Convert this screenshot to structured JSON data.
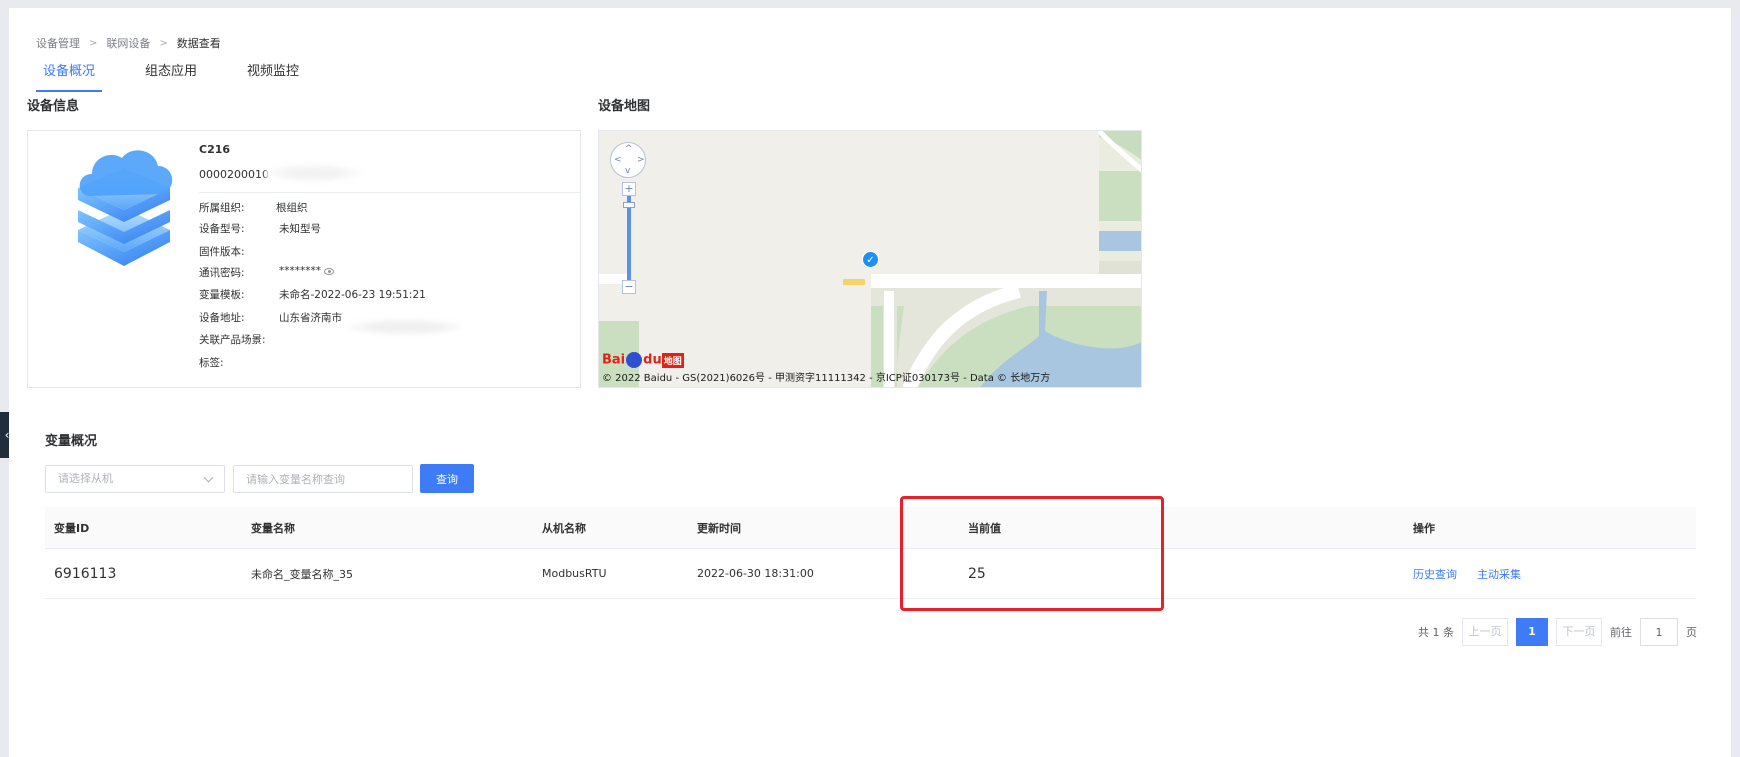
{
  "breadcrumb": [
    "设备管理",
    "联网设备",
    "数据查看"
  ],
  "tabs": [
    {
      "label": "设备概况",
      "active": true
    },
    {
      "label": "组态应用",
      "active": false
    },
    {
      "label": "视频监控",
      "active": false
    }
  ],
  "device_info": {
    "title": "设备信息",
    "name": "C216",
    "code": "0000200010",
    "rows": [
      {
        "label": "所属组织:",
        "value": "根组织"
      },
      {
        "label": "设备型号:",
        "value": "未知型号"
      },
      {
        "label": "固件版本:",
        "value": ""
      },
      {
        "label": "通讯密码:",
        "value": "********"
      },
      {
        "label": "变量模板:",
        "value": "未命名-2022-06-23 19:51:21"
      },
      {
        "label": "设备地址:",
        "value": "山东省济南市"
      },
      {
        "label": "关联产品场景:",
        "value": ""
      },
      {
        "label": "标签:",
        "value": ""
      }
    ]
  },
  "device_map": {
    "title": "设备地图",
    "copyright": "© 2022 Baidu - GS(2021)6026号 - 甲测资字11111342 - 京ICP证030173号 - Data © 长地万方",
    "logo_text": "Bai",
    "logo_text2": "du",
    "logo_map": "地图"
  },
  "variables": {
    "title": "变量概况",
    "select_placeholder": "请选择从机",
    "search_placeholder": "请输入变量名称查询",
    "query_label": "查询",
    "columns": [
      "变量ID",
      "变量名称",
      "从机名称",
      "更新时间",
      "当前值",
      "操作"
    ],
    "rows": [
      {
        "id": "6916113",
        "name": "未命名_变量名称_35",
        "slave": "ModbusRTU",
        "time": "2022-06-30 18:31:00",
        "value": "25",
        "actions": [
          "历史查询",
          "主动采集"
        ]
      }
    ]
  },
  "pagination": {
    "total": "共 1 条",
    "prev": "上一页",
    "current": "1",
    "next": "下一页",
    "goto_label": "前往",
    "goto_value": "1",
    "page_unit": "页"
  },
  "colors": {
    "accent": "#3e7bf7",
    "highlight": "#e8202a"
  }
}
